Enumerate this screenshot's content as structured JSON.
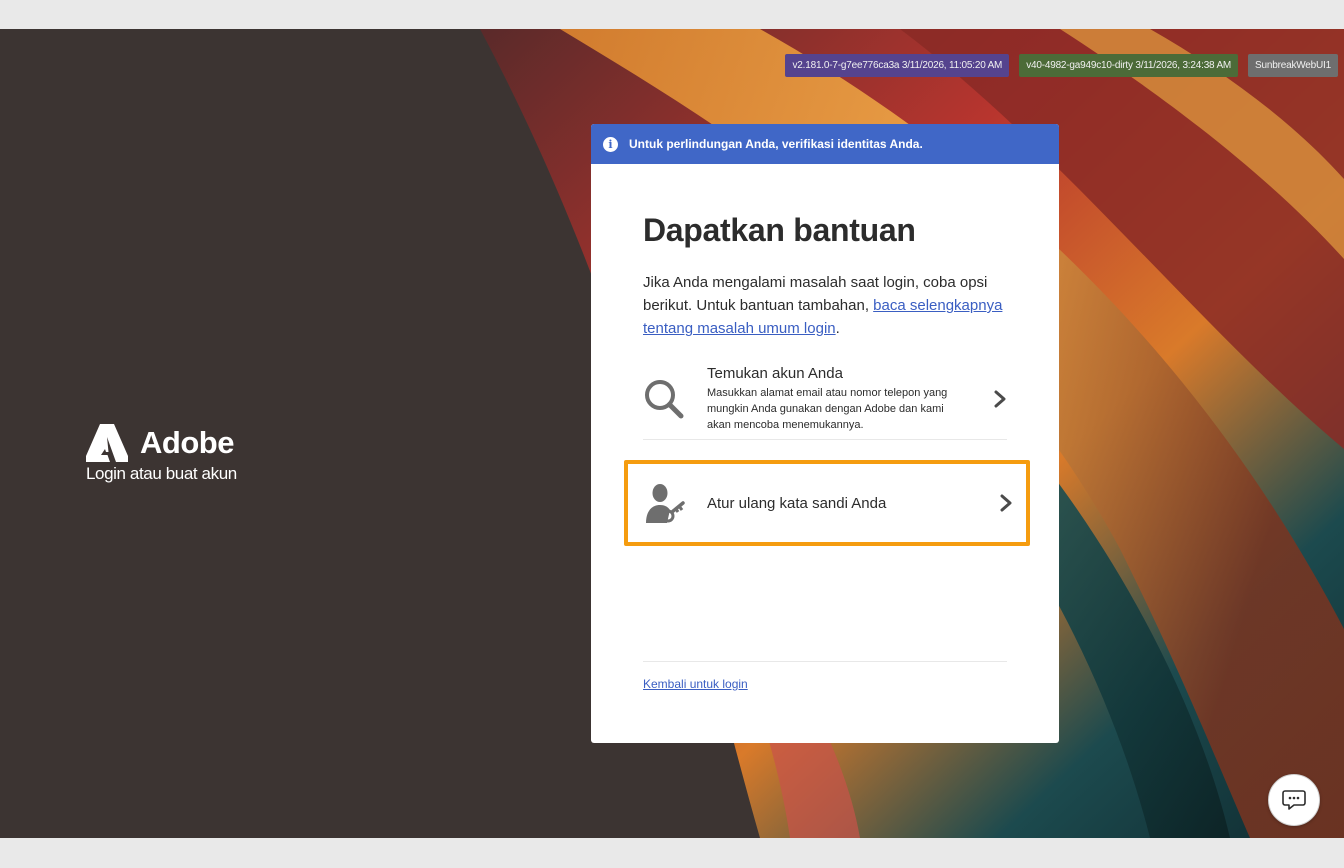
{
  "badges": [
    {
      "text": "v2.181.0-7-g7ee776ca3a 3/11/2026, 11:05:20 AM"
    },
    {
      "text": "v40-4982-ga949c10-dirty 3/11/2026, 3:24:38 AM"
    },
    {
      "text": "SunbreakWebUI1"
    }
  ],
  "brand": {
    "name": "Adobe",
    "subtitle": "Login atau buat akun"
  },
  "banner": {
    "text": "Untuk perlindungan Anda, verifikasi identitas Anda."
  },
  "card": {
    "title": "Dapatkan bantuan",
    "desc_prefix": "Jika Anda mengalami masalah saat login, coba opsi berikut. Untuk bantuan tambahan, ",
    "desc_link": "baca selengkapnya tentang masalah umum login",
    "desc_suffix": ".",
    "options": [
      {
        "title": "Temukan akun Anda",
        "detail": "Masukkan alamat email atau nomor telepon yang mungkin Anda gunakan dengan Adobe dan kami akan mencoba menemukannya.",
        "icon": "search-icon"
      },
      {
        "title": "Atur ulang kata sandi Anda",
        "icon": "user-key-icon"
      }
    ],
    "back_link": "Kembali untuk login"
  },
  "colors": {
    "banner": "#4067c7",
    "highlight": "#f59c0f",
    "link": "#3a5ec2",
    "backdrop": "#3c3432"
  }
}
